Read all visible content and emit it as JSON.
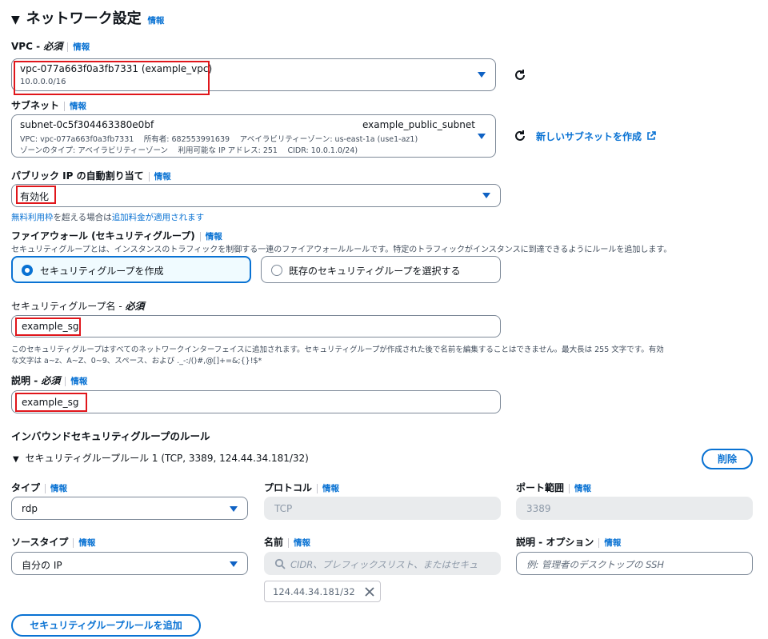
{
  "section": {
    "title": "ネットワーク設定",
    "info": "情報"
  },
  "vpc": {
    "label": "VPC",
    "required": "必須",
    "info": "情報",
    "value": "vpc-077a663f0a3fb7331 (example_vpc)",
    "cidr": "10.0.0.0/16"
  },
  "subnet": {
    "label": "サブネット",
    "info": "情報",
    "id": "subnet-0c5f304463380e0bf",
    "name": "example_public_subnet",
    "line2": "VPC: vpc-077a663f0a3fb7331　 所有者: 682553991639　 アベイラビリティーゾーン: us-east-1a (use1-az1)",
    "line3": "ゾーンのタイプ: アベイラビリティーゾーン　 利用可能な IP アドレス: 251　 CIDR: 10.0.1.0/24)",
    "create_link": "新しいサブネットを作成"
  },
  "public_ip": {
    "label": "パブリック IP の自動割り当て",
    "info": "情報",
    "value": "有効化",
    "note_link1": "無料利用枠",
    "note_mid": "を超える場合は",
    "note_link2": "追加料金が適用されます"
  },
  "firewall": {
    "label": "ファイアウォール (セキュリティグループ)",
    "info": "情報",
    "desc": "セキュリティグループとは、インスタンスのトラフィックを制御する一連のファイアウォールルールです。特定のトラフィックがインスタンスに到達できるようにルールを追加します。",
    "option_create": "セキュリティグループを作成",
    "option_existing": "既存のセキュリティグループを選択する"
  },
  "sg_name": {
    "label": "セキュリティグループ名",
    "required": "必須",
    "value": "example_sg",
    "help1": "このセキュリティグループはすべてのネットワークインターフェイスに追加されます。セキュリティグループが作成された後で名前を編集することはできません。最大長は 255 文字です。有効",
    "help2": "な文字は a~z、A~Z、0~9、スペース、および ._-:/()#,@[]+=&;{}!$*"
  },
  "description": {
    "label": "説明",
    "required": "必須",
    "info": "情報",
    "value": "example_sg"
  },
  "inbound": {
    "title": "インバウンドセキュリティグループのルール",
    "rule_title": "セキュリティグループルール 1 (TCP, 3389, 124.44.34.181/32)",
    "delete": "削除",
    "type_label": "タイプ",
    "type_value": "rdp",
    "protocol_label": "プロトコル",
    "protocol_value": "TCP",
    "port_label": "ポート範囲",
    "port_value": "3389",
    "source_type_label": "ソースタイプ",
    "source_type_value": "自分の IP",
    "name_label": "名前",
    "name_placeholder": "CIDR、プレフィックスリスト、またはセキュ",
    "token": "124.44.34.181/32",
    "desc_label": "説明 - オプション",
    "desc_placeholder": "例: 管理者のデスクトップの SSH",
    "info": "情報",
    "add_rule": "セキュリティグループルールを追加"
  },
  "colors": {
    "accent": "#0972d3",
    "highlight": "#e0161b",
    "selected_bg": "#f0fbff"
  }
}
